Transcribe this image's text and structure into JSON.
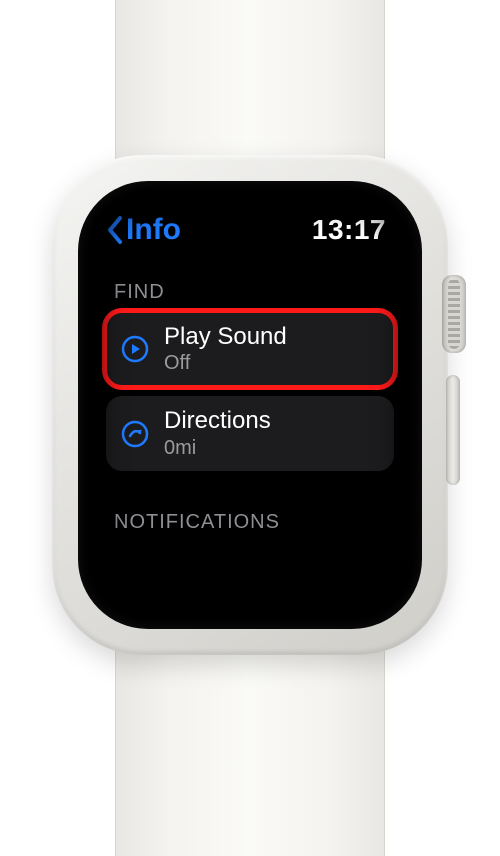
{
  "header": {
    "back_label": "Info",
    "time": "13:17"
  },
  "sections": {
    "find_label": "FIND",
    "notifications_label": "NOTIFICATIONS"
  },
  "cells": {
    "play_sound": {
      "title": "Play Sound",
      "subtitle": "Off"
    },
    "directions": {
      "title": "Directions",
      "subtitle": "0mi"
    }
  },
  "colors": {
    "accent": "#1e7bff",
    "highlight": "#ff1a1a"
  }
}
